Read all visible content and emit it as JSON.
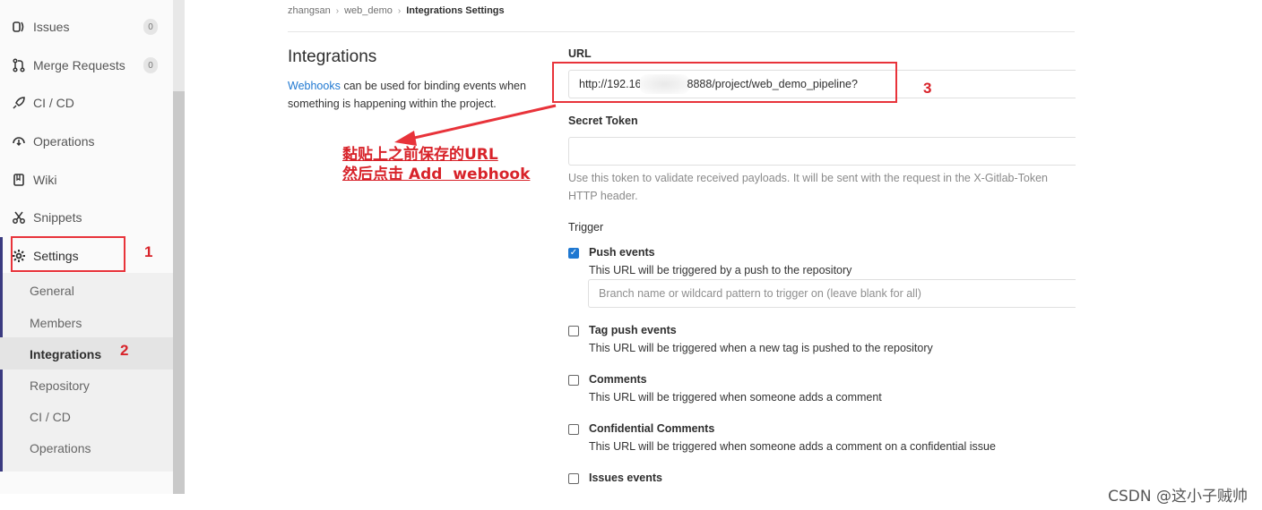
{
  "sidebar": {
    "items": [
      {
        "label": "Issues",
        "badge": "0",
        "icon": "issues-icon"
      },
      {
        "label": "Merge Requests",
        "badge": "0",
        "icon": "merge-request-icon"
      },
      {
        "label": "CI / CD",
        "icon": "rocket-icon"
      },
      {
        "label": "Operations",
        "icon": "cloud-icon"
      },
      {
        "label": "Wiki",
        "icon": "book-icon"
      },
      {
        "label": "Snippets",
        "icon": "scissors-icon"
      },
      {
        "label": "Settings",
        "icon": "gear-icon"
      }
    ],
    "subitems": [
      "General",
      "Members",
      "Integrations",
      "Repository",
      "CI / CD",
      "Operations"
    ],
    "active_subitem": "Integrations"
  },
  "breadcrumb": {
    "user": "zhangsan",
    "project": "web_demo",
    "current": "Integrations Settings"
  },
  "intro": {
    "title": "Integrations",
    "link": "Webhooks",
    "text": "can be used for binding events when something is happening within the project."
  },
  "form": {
    "url_label": "URL",
    "url_value_prefix": "http://192.16",
    "url_value_suffix": "8888/project/web_demo_pipeline?",
    "secret_label": "Secret Token",
    "secret_help_1": "Use this token to validate received payloads. It will be sent with the request in the X-Gitlab-Token",
    "secret_help_2": "HTTP header.",
    "trigger_label": "Trigger",
    "push_placeholder": "Branch name or wildcard pattern to trigger on (leave blank for all)",
    "triggers": [
      {
        "title": "Push events",
        "help": "This URL will be triggered by a push to the repository",
        "checked": true
      },
      {
        "title": "Tag push events",
        "help": "This URL will be triggered when a new tag is pushed to the repository",
        "checked": false
      },
      {
        "title": "Comments",
        "help": "This URL will be triggered when someone adds a comment",
        "checked": false
      },
      {
        "title": "Confidential Comments",
        "help": "This URL will be triggered when someone adds a comment on a confidential issue",
        "checked": false
      },
      {
        "title": "Issues events",
        "help": "",
        "checked": false
      }
    ]
  },
  "annotations": {
    "num1": "1",
    "num2": "2",
    "num3": "3",
    "line1": "黏贴上之前保存的URL",
    "line2": "然后点击 Add  webhook",
    "color": "#d8232a"
  },
  "watermark": "CSDN @这小子贼帅"
}
